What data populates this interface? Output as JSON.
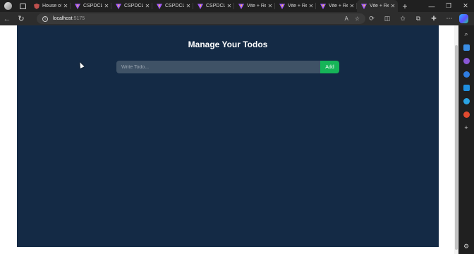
{
  "tabs": [
    {
      "title": "House of",
      "icon": "shield-icon",
      "color": "#c0504d"
    },
    {
      "title": "CSPDCL",
      "icon": "vite-icon",
      "color": "#a259ff"
    },
    {
      "title": "CSPDCL",
      "icon": "vite-icon",
      "color": "#a259ff"
    },
    {
      "title": "CSPDCL",
      "icon": "vite-icon",
      "color": "#a259ff"
    },
    {
      "title": "CSPDCL",
      "icon": "vite-icon",
      "color": "#a259ff"
    },
    {
      "title": "Vite + Rea",
      "icon": "vite-icon",
      "color": "#a259ff"
    },
    {
      "title": "Vite + Rea",
      "icon": "vite-icon",
      "color": "#a259ff"
    },
    {
      "title": "Vite + Rea",
      "icon": "vite-icon",
      "color": "#a259ff"
    },
    {
      "title": "Vite + Re",
      "icon": "vite-icon",
      "color": "#a259ff",
      "active": true
    }
  ],
  "address": {
    "host": "localhost",
    "port": ":5175"
  },
  "page": {
    "heading": "Manage Your Todos",
    "input_placeholder": "Write Todo...",
    "add_label": "Add"
  },
  "colors": {
    "app_background": "#142a45",
    "input_background": "#3f5266",
    "add_button": "#16b458"
  }
}
